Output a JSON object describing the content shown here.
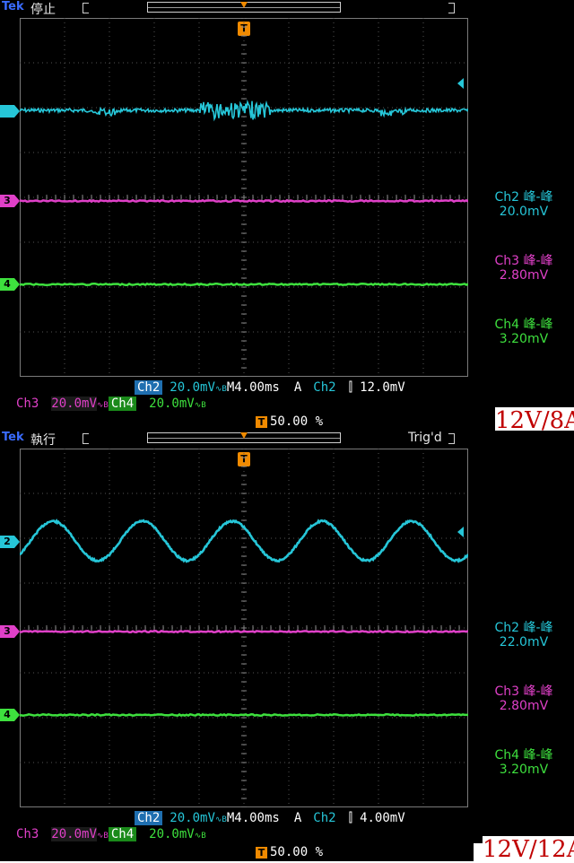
{
  "colors": {
    "ch2": "#26c6d8",
    "ch3": "#e040c8",
    "ch4": "#3ee03e",
    "trigger": "#f08a00",
    "caption": "#c00000",
    "ch2_label_bg": "#1f6fb0",
    "ch4_label_bg": "#1a8a1a"
  },
  "scope1": {
    "brand": "Tek",
    "state": "停止",
    "trig_status": "",
    "trigger_marker": "T",
    "ch_markers": {
      "ch2": "2",
      "ch3": "3",
      "ch4": "4"
    },
    "bottom": {
      "ch2_label": "Ch2",
      "ch2_scale": "20.0mV",
      "ch2_bw": "∿B",
      "timebase": "M4.00ms",
      "trig_mode": "A",
      "trig_src": "Ch2",
      "trig_slope": "⫿",
      "trig_level": "12.0mV",
      "ch3_label": "Ch3",
      "ch3_scale": "20.0mV",
      "ch3_bw": "∿B",
      "ch4_label": "Ch4",
      "ch4_scale": "20.0mV",
      "ch4_bw": "∿B",
      "cursor_icon": "T",
      "cursor_pos": "50.00 %"
    },
    "measurements": [
      {
        "name": "Ch2 峰-峰",
        "value": "20.0mV"
      },
      {
        "name": "Ch3 峰-峰",
        "value": "2.80mV"
      },
      {
        "name": "Ch4 峰-峰",
        "value": "3.20mV"
      }
    ],
    "caption": "12V/8A"
  },
  "scope2": {
    "brand": "Tek",
    "state": "執行",
    "trig_status": "Trig'd",
    "trigger_marker": "T",
    "ch_markers": {
      "ch2": "2",
      "ch3": "3",
      "ch4": "4"
    },
    "bottom": {
      "ch2_label": "Ch2",
      "ch2_scale": "20.0mV",
      "ch2_bw": "∿B",
      "timebase": "M4.00ms",
      "trig_mode": "A",
      "trig_src": "Ch2",
      "trig_slope": "⫿",
      "trig_level": "4.00mV",
      "ch3_label": "Ch3",
      "ch3_scale": "20.0mV",
      "ch3_bw": "∿B",
      "ch4_label": "Ch4",
      "ch4_scale": "20.0mV",
      "ch4_bw": "∿B",
      "cursor_icon": "T",
      "cursor_pos": "50.00 %"
    },
    "measurements": [
      {
        "name": "Ch2 峰-峰",
        "value": "22.0mV"
      },
      {
        "name": "Ch3 峰-峰",
        "value": "2.80mV"
      },
      {
        "name": "Ch4 峰-峰",
        "value": "3.20mV"
      }
    ],
    "caption": "12V/12A"
  }
}
